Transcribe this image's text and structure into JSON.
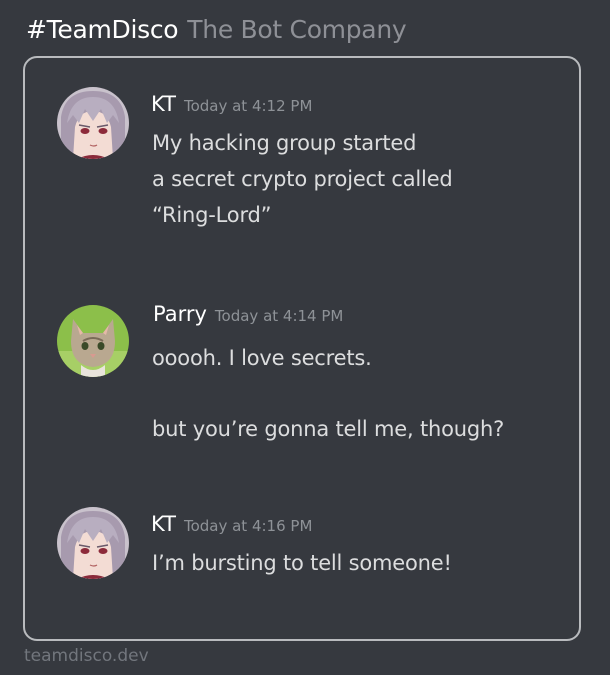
{
  "header": {
    "tag": "#TeamDisco",
    "name": "The Bot Company"
  },
  "messages": [
    {
      "author": "KT",
      "timestamp": "Today at 4:12 PM",
      "lines": [
        "My hacking group started",
        "a secret crypto project called",
        "“Ring-Lord”"
      ],
      "avatar": "anime-girl-avatar"
    },
    {
      "author": "Parry",
      "timestamp": "Today at 4:14 PM",
      "lines": [
        "ooooh.  I love secrets.",
        "but you’re gonna tell me, though?"
      ],
      "avatar": "kitten-avatar"
    },
    {
      "author": "KT",
      "timestamp": "Today at 4:16 PM",
      "lines": [
        "I’m bursting to tell someone!"
      ],
      "avatar": "anime-girl-avatar"
    }
  ],
  "footer": {
    "site": "teamdisco.dev"
  },
  "colors": {
    "background": "#36393f",
    "text": "#dcddde",
    "muted": "#8e9297",
    "border": "#b9bbbe"
  }
}
